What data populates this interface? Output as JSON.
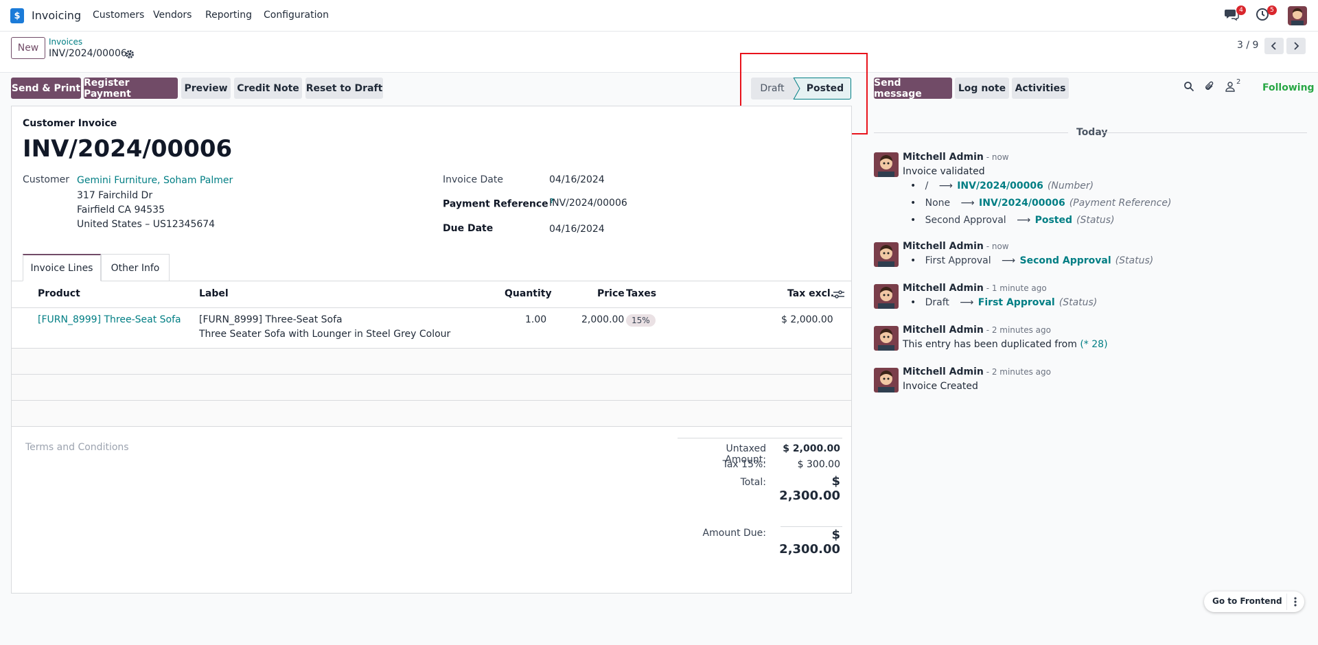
{
  "navbar": {
    "app_name": "Invoicing",
    "menu": [
      "Customers",
      "Vendors",
      "Reporting",
      "Configuration"
    ],
    "messages_badge": "4",
    "activities_badge": "5"
  },
  "control_panel": {
    "new_label": "New",
    "breadcrumb_parent": "Invoices",
    "breadcrumb_current": "INV/2024/00006",
    "pager": "3 / 9"
  },
  "actions": {
    "send_print": "Send & Print",
    "register_payment": "Register Payment",
    "preview": "Preview",
    "credit_note": "Credit Note",
    "reset_to_draft": "Reset to Draft"
  },
  "statusbar": {
    "draft": "Draft",
    "posted": "Posted"
  },
  "chatter_actions": {
    "send_message": "Send message",
    "log_note": "Log note",
    "activities": "Activities",
    "followers_count": "2",
    "following": "Following"
  },
  "form": {
    "subtitle": "Customer Invoice",
    "title": "INV/2024/00006",
    "customer_label": "Customer",
    "customer_name": "Gemini Furniture, Soham Palmer",
    "customer_address": [
      "317 Fairchild Dr",
      "Fairfield CA 94535",
      "United States – US12345674"
    ],
    "invoice_date_label": "Invoice Date",
    "invoice_date": "04/16/2024",
    "payment_ref_label": "Payment Reference",
    "payment_ref_tooltip": "?",
    "payment_ref": "INV/2024/00006",
    "due_date_label": "Due Date",
    "due_date": "04/16/2024"
  },
  "tabs": [
    "Invoice Lines",
    "Other Info"
  ],
  "lines": {
    "headers": {
      "product": "Product",
      "label": "Label",
      "quantity": "Quantity",
      "price": "Price",
      "taxes": "Taxes",
      "tax_excl": "Tax excl."
    },
    "rows": [
      {
        "product": "[FURN_8999] Three-Seat Sofa",
        "label_line1": "[FURN_8999] Three-Seat Sofa",
        "label_line2": "Three Seater Sofa with Lounger in Steel Grey Colour",
        "quantity": "1.00",
        "price": "2,000.00",
        "tax": "15%",
        "subtotal": "$ 2,000.00"
      }
    ]
  },
  "terms_placeholder": "Terms and Conditions",
  "totals": {
    "untaxed_label": "Untaxed Amount:",
    "untaxed": "$ 2,000.00",
    "tax_label": "Tax 15%:",
    "tax": "$ 300.00",
    "total_label": "Total:",
    "total": "$ 2,300.00",
    "amount_due_label": "Amount Due:",
    "amount_due": "$ 2,300.00"
  },
  "chatter": {
    "date_separator": "Today",
    "messages": [
      {
        "author": "Mitchell Admin",
        "meta": " - now",
        "text": "Invoice validated",
        "tracking": [
          {
            "old": "/",
            "new": "INV/2024/00006",
            "field": "(Number)"
          },
          {
            "old": "None",
            "new": "INV/2024/00006",
            "field": "(Payment Reference)"
          },
          {
            "old": "Second Approval",
            "new": "Posted",
            "field": "(Status)"
          }
        ]
      },
      {
        "author": "Mitchell Admin",
        "meta": " - now",
        "tracking": [
          {
            "old": "First Approval",
            "new": "Second Approval",
            "field": "(Status)"
          }
        ]
      },
      {
        "author": "Mitchell Admin",
        "meta": " - 1 minute ago",
        "tracking": [
          {
            "old": "Draft",
            "new": "First Approval",
            "field": "(Status)"
          }
        ]
      },
      {
        "author": "Mitchell Admin",
        "meta": " - 2 minutes ago",
        "text": "This entry has been duplicated from ",
        "link": "(* 28)"
      },
      {
        "author": "Mitchell Admin",
        "meta": " - 2 minutes ago",
        "text": "Invoice Created"
      }
    ]
  },
  "go_frontend": "Go to Frontend",
  "colors": {
    "primary": "#714b67",
    "link": "#017e84",
    "following": "#28a745",
    "highlight": "#e8121b"
  }
}
